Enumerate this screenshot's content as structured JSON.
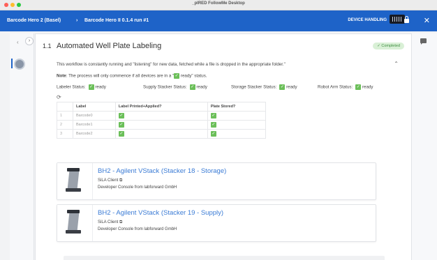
{
  "window": {
    "title": "_pIRED FollowMe Desktop"
  },
  "colors": {
    "appbar": "#1e63c8",
    "success": "#6bbf59",
    "link": "#3a7bd5",
    "dot_red": "#ff5f57",
    "dot_yellow": "#febc2e",
    "dot_green": "#28c840"
  },
  "appbar": {
    "crumb_root": "Barcode Hero 2 (Basel)",
    "separator": "›",
    "crumb_current": "Barcode Hero II 0.1.4 run #1",
    "device_handling": "DEVICE HANDLING",
    "close": "✕"
  },
  "nav": {
    "back": "‹",
    "forward": "›"
  },
  "section": {
    "number": "1.1",
    "title": "Automated Well Plate Labeling",
    "status_badge": "✓ Completed",
    "description": "This workflow is constantly running and \"listening\" for new data, fetched while a file is dropped in the appropriate folder.\"",
    "collapse": "⌃",
    "note_label": "Note",
    "note_text": ": The process will only commence if all devices are in a \"",
    "note_text2": " ready\" status."
  },
  "statuses": [
    {
      "label": "Labeler Status:",
      "value": "ready"
    },
    {
      "label": "Supply Stacker Status:",
      "value": "ready"
    },
    {
      "label": "Storage Stacker Status:",
      "value": "ready"
    },
    {
      "label": "Robot Arm Status:",
      "value": "ready"
    }
  ],
  "refresh_icon": "⟳",
  "table": {
    "headers": [
      "",
      "Label",
      "Label Printed+Applied?",
      "Plate Stored?"
    ],
    "rows": [
      {
        "idx": "1",
        "label": "Barcode0"
      },
      {
        "idx": "2",
        "label": "Barcode1"
      },
      {
        "idx": "3",
        "label": "Barcode2"
      }
    ]
  },
  "devices": [
    {
      "title": "BH2 - Agilent VStack (Stacker 18 - Storage)",
      "client": "SiLA Client",
      "client_icon": "⧉",
      "vendor": "Developer Console from labforward GmbH"
    },
    {
      "title": "BH2 - Agilent VStack (Stacker 19 - Supply)",
      "client": "SiLA Client",
      "client_icon": "⧉",
      "vendor": "Developer Console from labforward GmbH"
    }
  ],
  "check": "✓"
}
